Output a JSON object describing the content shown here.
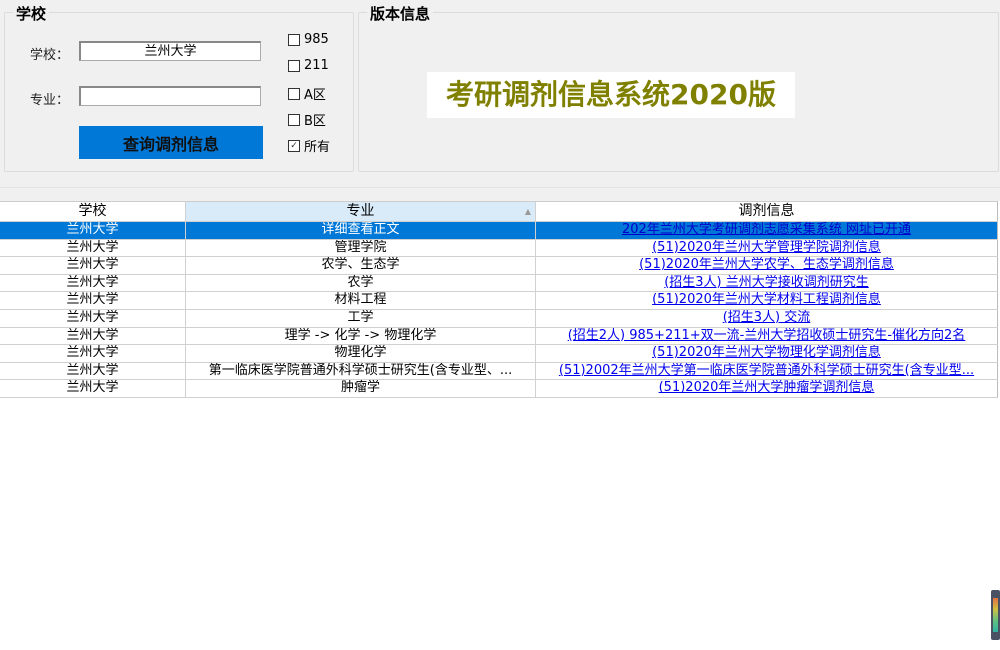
{
  "school_group": {
    "title": "学校",
    "school_label": "学校：",
    "school_value": "兰州大学",
    "major_label": "专业：",
    "major_value": "",
    "query_button": "查询调剂信息",
    "checkboxes": [
      {
        "label": "985",
        "checked": false
      },
      {
        "label": "211",
        "checked": false
      },
      {
        "label": "A区",
        "checked": false
      },
      {
        "label": "B区",
        "checked": false
      },
      {
        "label": "所有",
        "checked": true
      }
    ]
  },
  "version_group": {
    "title": "版本信息",
    "banner": "考研调剂信息系统2020版",
    "banner_color": "#808000"
  },
  "grid": {
    "headers": [
      "学校",
      "专业",
      "调剂信息"
    ],
    "rows": [
      [
        "兰州大学",
        "详细查看正文",
        "202年兰州大学考研调剂志愿采集系统 网址已开通"
      ],
      [
        "兰州大学",
        "管理学院",
        "(51)2020年兰州大学管理学院调剂信息"
      ],
      [
        "兰州大学",
        "农学、生态学",
        "(51)2020年兰州大学农学、生态学调剂信息"
      ],
      [
        "兰州大学",
        "农学",
        "(招生3人) 兰州大学接收调剂研究生"
      ],
      [
        "兰州大学",
        "材料工程",
        "(51)2020年兰州大学材料工程调剂信息"
      ],
      [
        "兰州大学",
        "工学",
        "(招生3人) 交流"
      ],
      [
        "兰州大学",
        "理学 -> 化学  -> 物理化学",
        "(招生2人) 985+211+双一流-兰州大学招收硕士研究生-催化方向2名"
      ],
      [
        "兰州大学",
        "物理化学",
        "(51)2020年兰州大学物理化学调剂信息"
      ],
      [
        "兰州大学",
        "第一临床医学院普通外科学硕士研究生(含专业型、...",
        "(51)2002年兰州大学第一临床医学院普通外科学硕士研究生(含专业型..."
      ],
      [
        "兰州大学",
        "肿瘤学",
        "(51)2020年兰州大学肿瘤学调剂信息"
      ]
    ]
  }
}
